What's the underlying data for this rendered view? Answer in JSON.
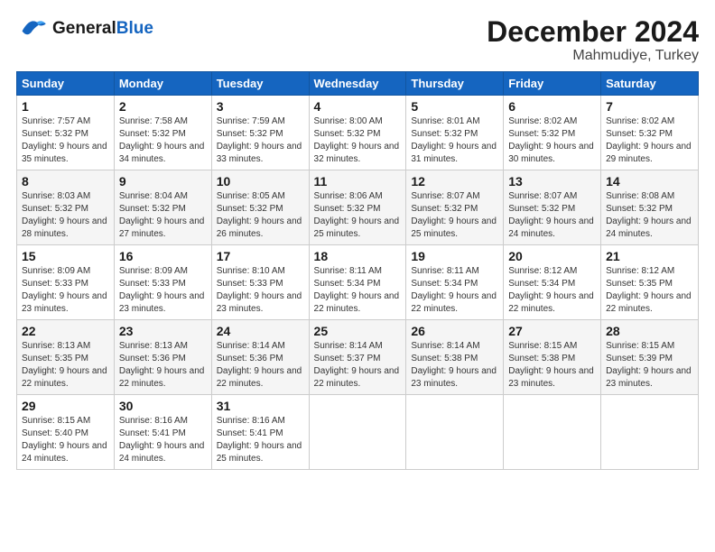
{
  "logo": {
    "line1": "General",
    "line2": "Blue"
  },
  "title": "December 2024",
  "subtitle": "Mahmudiye, Turkey",
  "days_header": [
    "Sunday",
    "Monday",
    "Tuesday",
    "Wednesday",
    "Thursday",
    "Friday",
    "Saturday"
  ],
  "weeks": [
    [
      {
        "day": "1",
        "sunrise": "7:57 AM",
        "sunset": "5:32 PM",
        "daylight": "9 hours and 35 minutes."
      },
      {
        "day": "2",
        "sunrise": "7:58 AM",
        "sunset": "5:32 PM",
        "daylight": "9 hours and 34 minutes."
      },
      {
        "day": "3",
        "sunrise": "7:59 AM",
        "sunset": "5:32 PM",
        "daylight": "9 hours and 33 minutes."
      },
      {
        "day": "4",
        "sunrise": "8:00 AM",
        "sunset": "5:32 PM",
        "daylight": "9 hours and 32 minutes."
      },
      {
        "day": "5",
        "sunrise": "8:01 AM",
        "sunset": "5:32 PM",
        "daylight": "9 hours and 31 minutes."
      },
      {
        "day": "6",
        "sunrise": "8:02 AM",
        "sunset": "5:32 PM",
        "daylight": "9 hours and 30 minutes."
      },
      {
        "day": "7",
        "sunrise": "8:02 AM",
        "sunset": "5:32 PM",
        "daylight": "9 hours and 29 minutes."
      }
    ],
    [
      {
        "day": "8",
        "sunrise": "8:03 AM",
        "sunset": "5:32 PM",
        "daylight": "9 hours and 28 minutes."
      },
      {
        "day": "9",
        "sunrise": "8:04 AM",
        "sunset": "5:32 PM",
        "daylight": "9 hours and 27 minutes."
      },
      {
        "day": "10",
        "sunrise": "8:05 AM",
        "sunset": "5:32 PM",
        "daylight": "9 hours and 26 minutes."
      },
      {
        "day": "11",
        "sunrise": "8:06 AM",
        "sunset": "5:32 PM",
        "daylight": "9 hours and 25 minutes."
      },
      {
        "day": "12",
        "sunrise": "8:07 AM",
        "sunset": "5:32 PM",
        "daylight": "9 hours and 25 minutes."
      },
      {
        "day": "13",
        "sunrise": "8:07 AM",
        "sunset": "5:32 PM",
        "daylight": "9 hours and 24 minutes."
      },
      {
        "day": "14",
        "sunrise": "8:08 AM",
        "sunset": "5:32 PM",
        "daylight": "9 hours and 24 minutes."
      }
    ],
    [
      {
        "day": "15",
        "sunrise": "8:09 AM",
        "sunset": "5:33 PM",
        "daylight": "9 hours and 23 minutes."
      },
      {
        "day": "16",
        "sunrise": "8:09 AM",
        "sunset": "5:33 PM",
        "daylight": "9 hours and 23 minutes."
      },
      {
        "day": "17",
        "sunrise": "8:10 AM",
        "sunset": "5:33 PM",
        "daylight": "9 hours and 23 minutes."
      },
      {
        "day": "18",
        "sunrise": "8:11 AM",
        "sunset": "5:34 PM",
        "daylight": "9 hours and 22 minutes."
      },
      {
        "day": "19",
        "sunrise": "8:11 AM",
        "sunset": "5:34 PM",
        "daylight": "9 hours and 22 minutes."
      },
      {
        "day": "20",
        "sunrise": "8:12 AM",
        "sunset": "5:34 PM",
        "daylight": "9 hours and 22 minutes."
      },
      {
        "day": "21",
        "sunrise": "8:12 AM",
        "sunset": "5:35 PM",
        "daylight": "9 hours and 22 minutes."
      }
    ],
    [
      {
        "day": "22",
        "sunrise": "8:13 AM",
        "sunset": "5:35 PM",
        "daylight": "9 hours and 22 minutes."
      },
      {
        "day": "23",
        "sunrise": "8:13 AM",
        "sunset": "5:36 PM",
        "daylight": "9 hours and 22 minutes."
      },
      {
        "day": "24",
        "sunrise": "8:14 AM",
        "sunset": "5:36 PM",
        "daylight": "9 hours and 22 minutes."
      },
      {
        "day": "25",
        "sunrise": "8:14 AM",
        "sunset": "5:37 PM",
        "daylight": "9 hours and 22 minutes."
      },
      {
        "day": "26",
        "sunrise": "8:14 AM",
        "sunset": "5:38 PM",
        "daylight": "9 hours and 23 minutes."
      },
      {
        "day": "27",
        "sunrise": "8:15 AM",
        "sunset": "5:38 PM",
        "daylight": "9 hours and 23 minutes."
      },
      {
        "day": "28",
        "sunrise": "8:15 AM",
        "sunset": "5:39 PM",
        "daylight": "9 hours and 23 minutes."
      }
    ],
    [
      {
        "day": "29",
        "sunrise": "8:15 AM",
        "sunset": "5:40 PM",
        "daylight": "9 hours and 24 minutes."
      },
      {
        "day": "30",
        "sunrise": "8:16 AM",
        "sunset": "5:41 PM",
        "daylight": "9 hours and 24 minutes."
      },
      {
        "day": "31",
        "sunrise": "8:16 AM",
        "sunset": "5:41 PM",
        "daylight": "9 hours and 25 minutes."
      },
      null,
      null,
      null,
      null
    ]
  ],
  "labels": {
    "sunrise": "Sunrise:",
    "sunset": "Sunset:",
    "daylight": "Daylight:"
  }
}
